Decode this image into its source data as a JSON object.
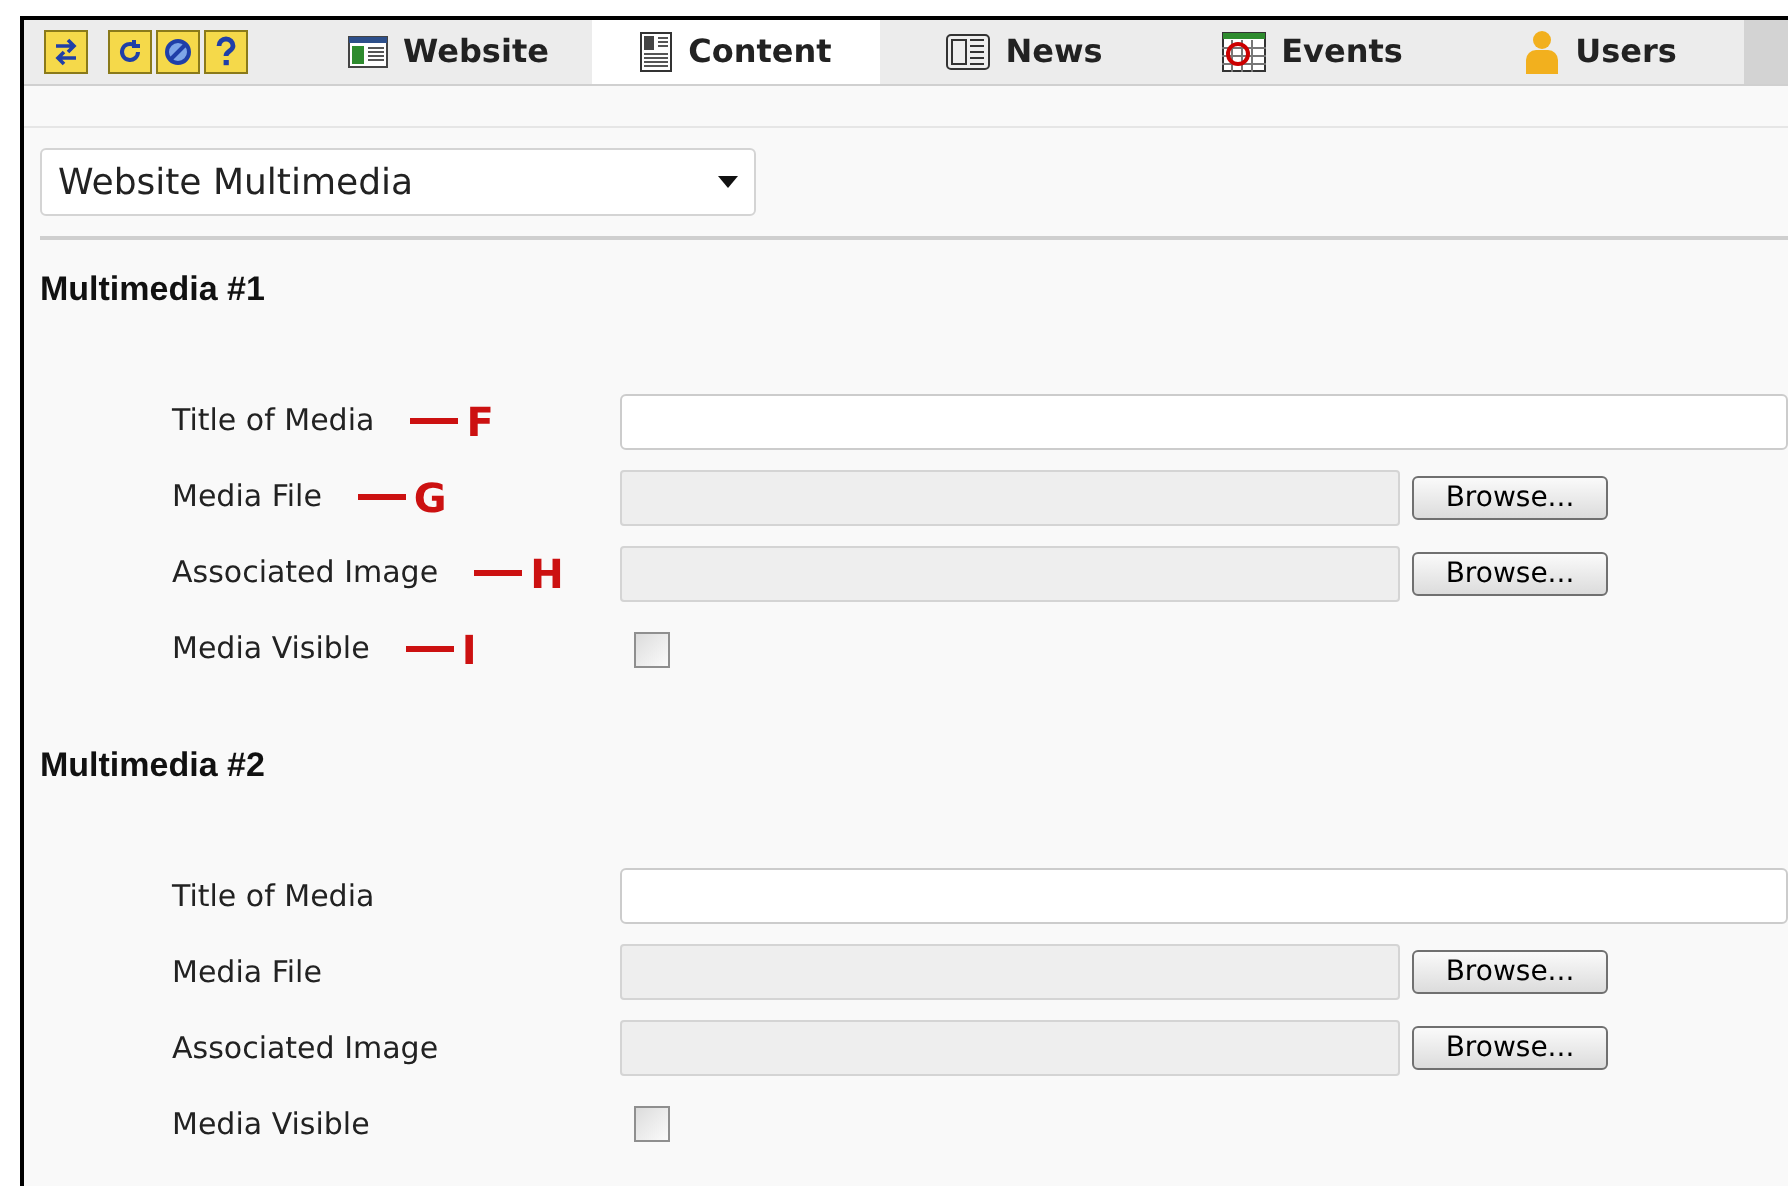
{
  "toolbar": {
    "tabs": [
      {
        "label": "Website",
        "kind": "website",
        "selected": false
      },
      {
        "label": "Content",
        "kind": "content",
        "selected": true
      },
      {
        "label": "News",
        "kind": "news",
        "selected": false
      },
      {
        "label": "Events",
        "kind": "events",
        "selected": false
      },
      {
        "label": "Users",
        "kind": "users",
        "selected": false
      }
    ]
  },
  "section_select": {
    "value": "Website Multimedia"
  },
  "sections": [
    {
      "heading": "Multimedia #1",
      "fields": [
        {
          "kind": "text",
          "label": "Title of Media",
          "annotation": "F"
        },
        {
          "kind": "file",
          "label": "Media File",
          "annotation": "G",
          "button": "Browse..."
        },
        {
          "kind": "file",
          "label": "Associated Image",
          "annotation": "H",
          "button": "Browse..."
        },
        {
          "kind": "checkbox",
          "label": "Media Visible",
          "annotation": "I",
          "checked": false
        }
      ]
    },
    {
      "heading": "Multimedia #2",
      "fields": [
        {
          "kind": "text",
          "label": "Title of Media"
        },
        {
          "kind": "file",
          "label": "Media File",
          "button": "Browse..."
        },
        {
          "kind": "file",
          "label": "Associated Image",
          "button": "Browse..."
        },
        {
          "kind": "checkbox",
          "label": "Media Visible",
          "checked": false
        }
      ]
    }
  ]
}
